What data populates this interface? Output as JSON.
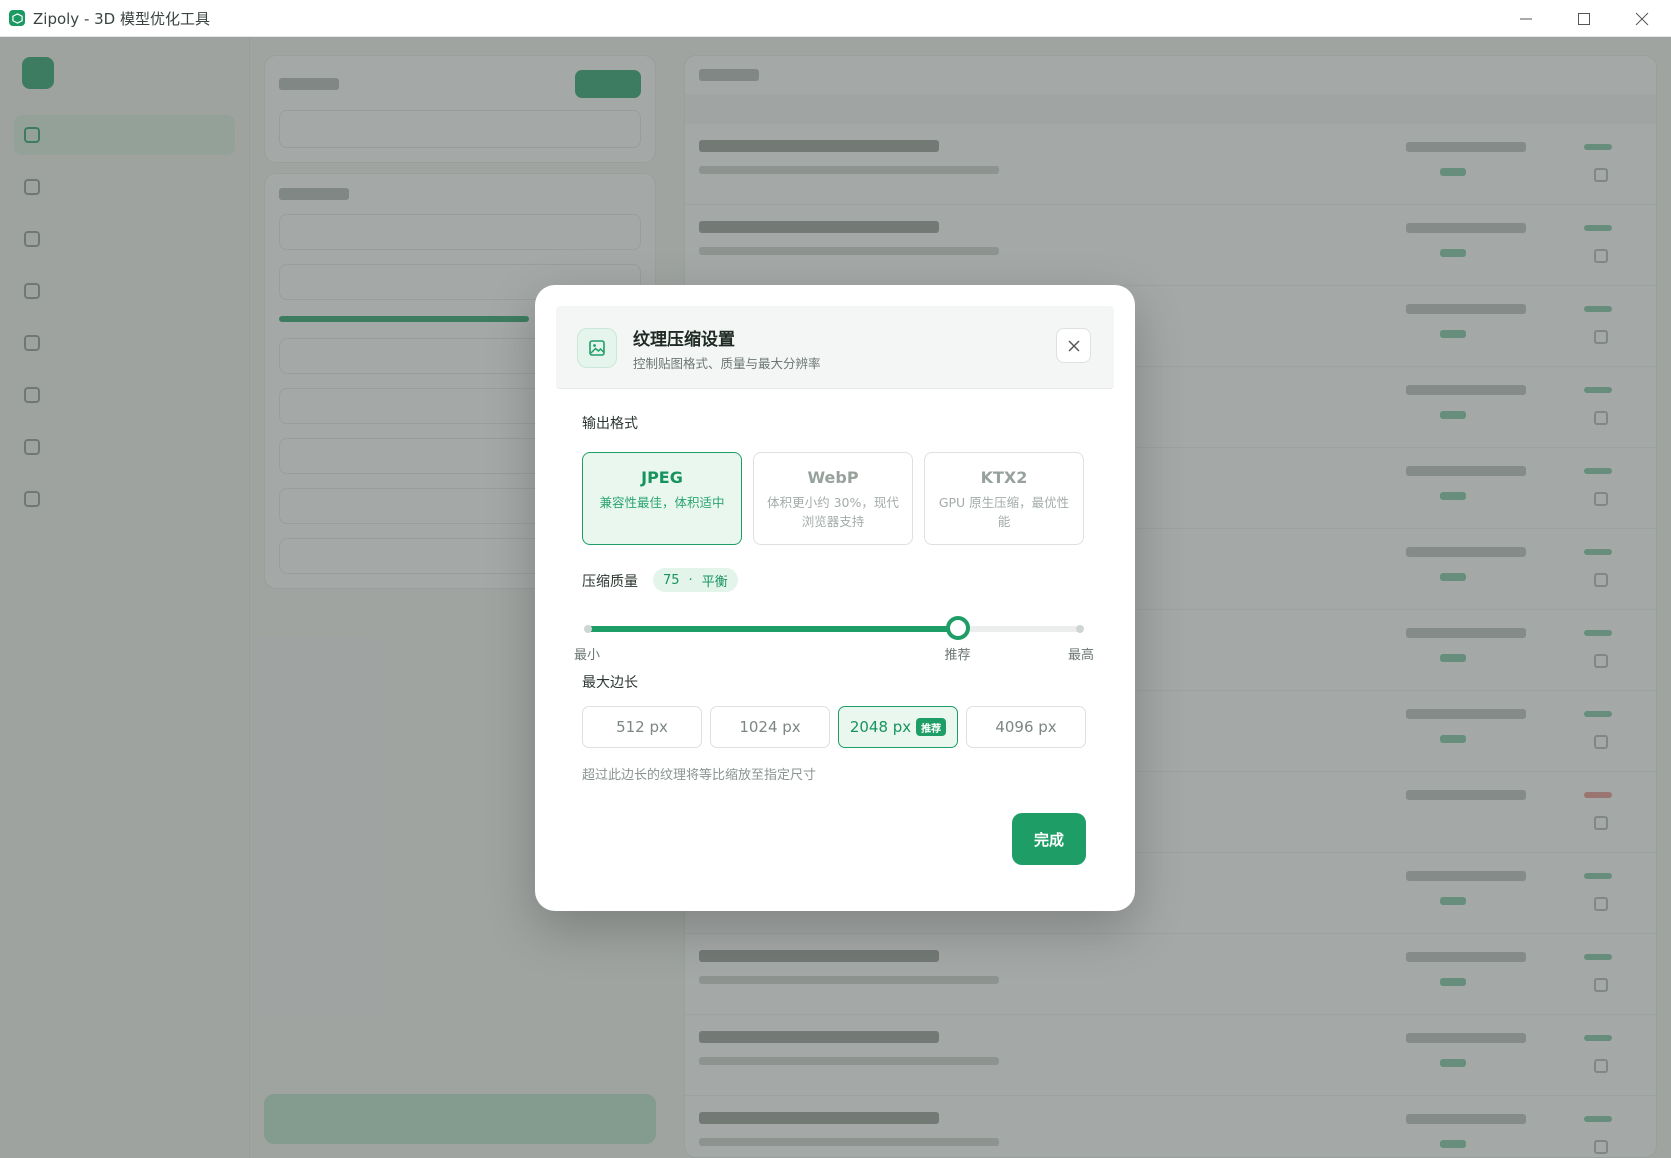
{
  "window": {
    "title": "Zipoly - 3D 模型优化工具",
    "app_icon": "app-logo-icon",
    "controls": [
      "minimize-icon",
      "maximize-icon",
      "close-icon"
    ]
  },
  "modal": {
    "icon": "image-icon",
    "title": "纹理压缩设置",
    "subtitle": "控制贴图格式、质量与最大分辨率",
    "close_icon": "close-icon",
    "output_format": {
      "label": "输出格式",
      "selected": "JPEG",
      "options": [
        {
          "name": "JPEG",
          "desc": "兼容性最佳，体积适中"
        },
        {
          "name": "WebP",
          "desc": "体积更小约 30%，现代浏览器支持"
        },
        {
          "name": "KTX2",
          "desc": "GPU 原生压缩，最优性能"
        }
      ]
    },
    "quality": {
      "label": "压缩质量",
      "value": 75,
      "value_text": "75",
      "separator": "·",
      "level": "平衡",
      "min": 0,
      "max": 100,
      "recommended": 75,
      "labels": {
        "min": "最小",
        "recommended": "推荐",
        "max": "最高"
      }
    },
    "max_edge": {
      "label": "最大边长",
      "options": [
        "512 px",
        "1024 px",
        "2048 px",
        "4096 px"
      ],
      "selected": "2048 px",
      "recommended_tag": "推荐",
      "hint": "超过此边长的纹理将等比缩放至指定尺寸"
    },
    "done_label": "完成"
  },
  "colors": {
    "accent": "#1e9e66",
    "accent_light": "#e9f7ef",
    "overlay": "rgba(90,96,93,0.55)",
    "error": "#e0443b"
  }
}
